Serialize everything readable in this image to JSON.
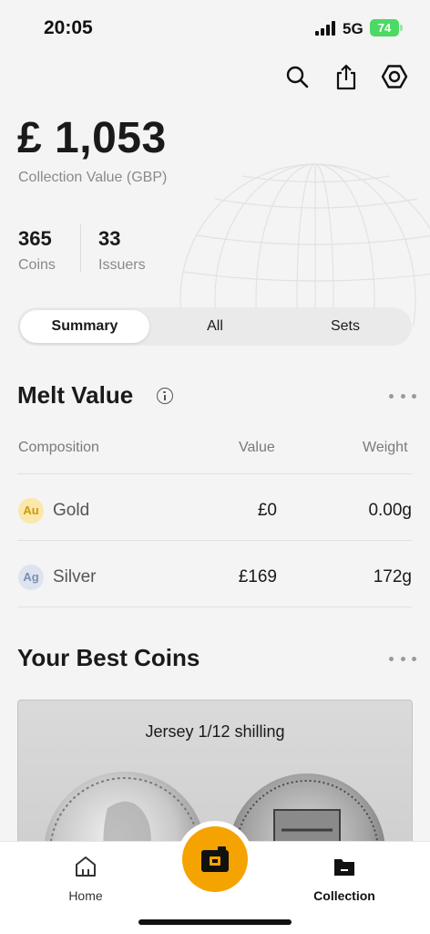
{
  "status_bar": {
    "time": "20:05",
    "network": "5G",
    "battery": "74"
  },
  "header": {
    "actions": [
      {
        "name": "search-icon"
      },
      {
        "name": "share-icon"
      },
      {
        "name": "settings-icon"
      }
    ]
  },
  "summary": {
    "total_value": "£ 1,053",
    "total_label": "Collection Value (GBP)",
    "coins_count": "365",
    "coins_label": "Coins",
    "issuers_count": "33",
    "issuers_label": "Issuers"
  },
  "tabs": [
    {
      "label": "Summary",
      "active": true
    },
    {
      "label": "All",
      "active": false
    },
    {
      "label": "Sets",
      "active": false
    }
  ],
  "melt_value": {
    "title": "Melt Value",
    "columns": {
      "composition": "Composition",
      "value": "Value",
      "weight": "Weight"
    },
    "rows": [
      {
        "symbol": "Au",
        "metal": "Gold",
        "value": "£0",
        "weight": "0.00g",
        "badge_bg": "#fbe7a8",
        "badge_fg": "#c99a12"
      },
      {
        "symbol": "Ag",
        "metal": "Silver",
        "value": "£169",
        "weight": "172g",
        "badge_bg": "#dde3ef",
        "badge_fg": "#7d8eb0"
      }
    ]
  },
  "best_coins": {
    "title": "Your Best Coins",
    "featured": {
      "name": "Jersey 1/12 shilling"
    }
  },
  "bottom_nav": {
    "home_label": "Home",
    "collection_label": "Collection",
    "camera_icon": "camera-icon"
  },
  "colors": {
    "accent": "#f5a300",
    "battery": "#4cd964"
  }
}
